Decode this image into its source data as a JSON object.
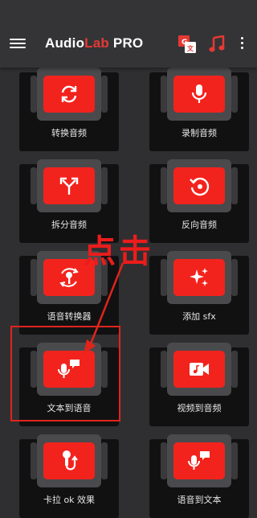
{
  "app": {
    "title_prefix": "Audio",
    "title_accent": "Lab",
    "title_suffix": " PRO"
  },
  "toolbar": {
    "menu_icon": "hamburger-menu-icon",
    "translate_icon": "translate-icon",
    "music_icon": "music-note-icon",
    "more_icon": "more-vert-icon"
  },
  "tools": [
    {
      "label": "转换音频",
      "icon": "convert-icon"
    },
    {
      "label": "录制音频",
      "icon": "microphone-icon"
    },
    {
      "label": "拆分音频",
      "icon": "split-icon"
    },
    {
      "label": "反向音频",
      "icon": "reverse-icon"
    },
    {
      "label": "语音转换器",
      "icon": "voice-changer-icon"
    },
    {
      "label": "添加 sfx",
      "icon": "sparkle-icon"
    },
    {
      "label": "文本到语音",
      "icon": "text-to-speech-icon"
    },
    {
      "label": "视频到音频",
      "icon": "video-to-audio-icon"
    },
    {
      "label": "卡拉 ok 效果",
      "icon": "karaoke-mic-icon"
    },
    {
      "label": "语音到文本",
      "icon": "speech-to-text-icon"
    }
  ],
  "annotation": {
    "text": "点击",
    "color": "#ec1c1c"
  },
  "colors": {
    "accent": "#f2231d",
    "background": "#2f2f31",
    "card": "#111112"
  }
}
